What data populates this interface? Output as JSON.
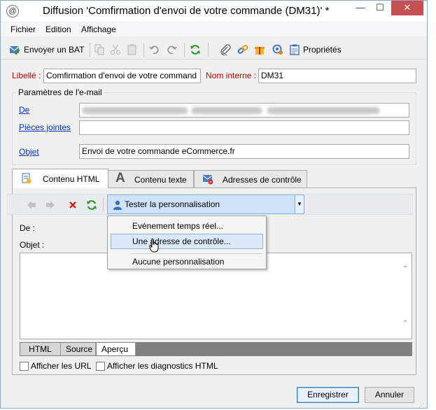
{
  "window": {
    "title": "Diffusion 'Comfirmation d'envoi de votre commande (DM31)' *",
    "icon": "@",
    "controls": {
      "minimize": "—",
      "maximize": "☐",
      "close": "✕"
    }
  },
  "menu": [
    "Fichier",
    "Edition",
    "Affichage"
  ],
  "toolbar": {
    "send_proof": "Envoyer un BAT",
    "properties": "Propriétés"
  },
  "form": {
    "label_label": "Libellé :",
    "label_value": "Comfirmation d'envoi de votre command",
    "internal_name_label": "Nom interne :",
    "internal_name_value": "DM31",
    "email_params_title": "Paramètres de l'e-mail",
    "from_label": "De",
    "attachments_label": "Pièces jointes",
    "attachments_value": "",
    "subject_label": "Objet",
    "subject_value": "Envoi de votre commande eCommerce.fr"
  },
  "tabs": {
    "html": "Contenu HTML",
    "text": "Contenu texte",
    "seeds": "Adresses de contrôle"
  },
  "panel": {
    "personalize_combo": "Tester la personnalisation",
    "from_label": "De :",
    "subject_label": "Objet :",
    "bottom_tabs": [
      "HTML",
      "Source",
      "Aperçu"
    ],
    "show_urls": "Afficher les URL",
    "show_html_diag": "Afficher les diagnostics HTML"
  },
  "dropdown": {
    "items": [
      "Evénement temps réel...",
      "Une adresse de contrôle...",
      "Aucune personnalisation"
    ]
  },
  "buttons": {
    "save": "Enregistrer",
    "cancel": "Annuler"
  },
  "colors": {
    "required_label": "#c00000",
    "link_label": "#0033cc",
    "accent": "#3c7fb1",
    "close_button": "#c75050"
  }
}
